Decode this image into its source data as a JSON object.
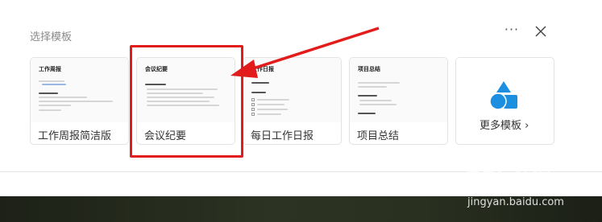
{
  "header": {
    "title": "选择模板",
    "more_glyph": "···"
  },
  "templates": [
    {
      "label": "工作周报简洁版",
      "thumb_title": "工作周报",
      "icon": "document-thumbnail"
    },
    {
      "label": "会议纪要",
      "thumb_title": "会议纪要",
      "icon": "document-thumbnail"
    },
    {
      "label": "每日工作日报",
      "thumb_title": "工作日报",
      "icon": "document-thumbnail"
    },
    {
      "label": "项目总结",
      "thumb_title": "项目总结",
      "icon": "document-thumbnail"
    }
  ],
  "more_templates": {
    "label": "更多模板",
    "chevron": "›",
    "icon": "shapes-logo-icon"
  },
  "watermark": {
    "top": "Bai 经验",
    "bottom": "jingyan.baidu.com"
  },
  "colors": {
    "highlight": "#e21b1b",
    "logo_blue": "#1d8fe1",
    "bottom_band": "#2a3020"
  }
}
